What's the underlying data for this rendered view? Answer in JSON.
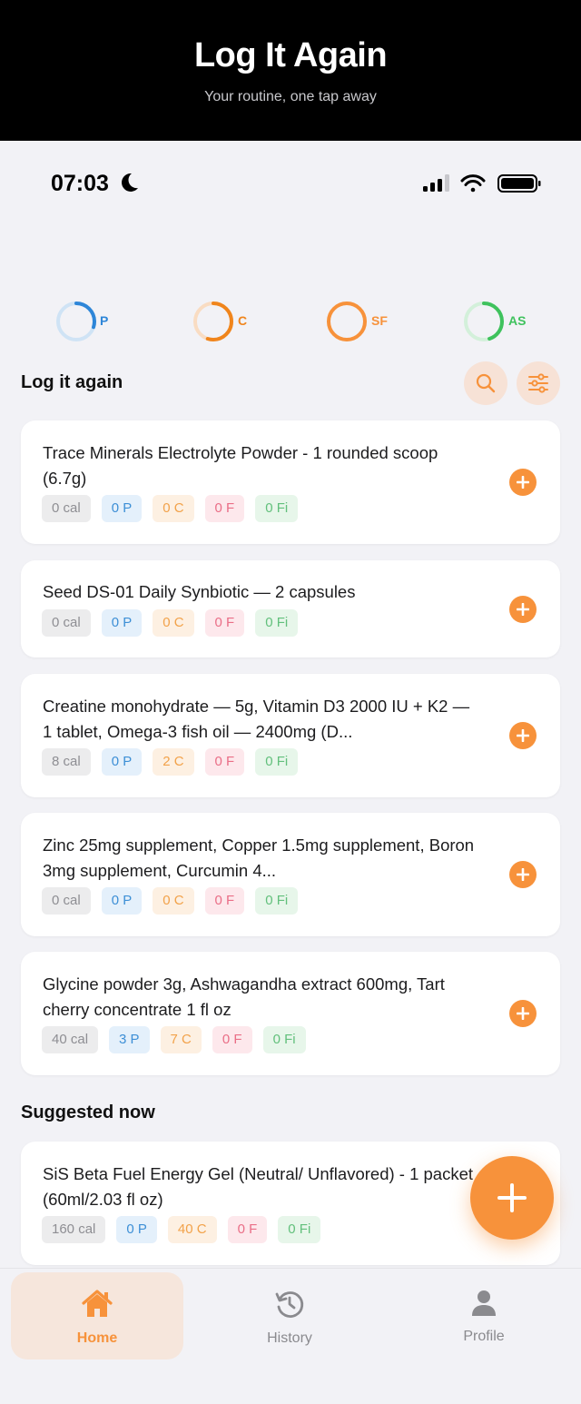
{
  "hero": {
    "title": "Log It Again",
    "subtitle": "Your routine, one tap away"
  },
  "status_bar": {
    "time": "07:03"
  },
  "rings": [
    {
      "label": "P",
      "color": "#2e86d8",
      "progress": 0.3
    },
    {
      "label": "C",
      "color": "#f0851c",
      "progress": 0.55
    },
    {
      "label": "SF",
      "color": "#f7923b",
      "progress": 1.0
    },
    {
      "label": "AS",
      "color": "#3fc25d",
      "progress": 0.45
    }
  ],
  "log_section": {
    "title": "Log it again"
  },
  "suggested_section": {
    "title": "Suggested now"
  },
  "cards": [
    {
      "title": "Trace Minerals Electrolyte Powder - 1 rounded scoop (6.7g)",
      "cal": "0 cal",
      "p": "0 P",
      "c": "0 C",
      "f": "0 F",
      "fi": "0 Fi"
    },
    {
      "title": "Seed DS-01 Daily Synbiotic — 2 capsules",
      "cal": "0 cal",
      "p": "0 P",
      "c": "0 C",
      "f": "0 F",
      "fi": "0 Fi"
    },
    {
      "title": "Creatine monohydrate — 5g, Vitamin D3 2000 IU + K2 — 1 tablet, Omega-3 fish oil — 2400mg (D...",
      "cal": "8 cal",
      "p": "0 P",
      "c": "2 C",
      "f": "0 F",
      "fi": "0 Fi"
    },
    {
      "title": "Zinc 25mg supplement, Copper 1.5mg supplement, Boron 3mg supplement, Curcumin 4...",
      "cal": "0 cal",
      "p": "0 P",
      "c": "0 C",
      "f": "0 F",
      "fi": "0 Fi"
    },
    {
      "title": "Glycine powder 3g, Ashwagandha extract 600mg, Tart cherry concentrate 1 fl oz",
      "cal": "40 cal",
      "p": "3 P",
      "c": "7 C",
      "f": "0 F",
      "fi": "0 Fi"
    }
  ],
  "suggested": [
    {
      "title": "SiS Beta Fuel Energy Gel (Neutral/ Unflavored) - 1 packet (60ml/2.03 fl oz)",
      "cal": "160 cal",
      "p": "0 P",
      "c": "40 C",
      "f": "0 F",
      "fi": "0 Fi"
    }
  ],
  "tabs": [
    {
      "label": "Home",
      "icon": "home-icon",
      "active": true
    },
    {
      "label": "History",
      "icon": "history-icon",
      "active": false
    },
    {
      "label": "Profile",
      "icon": "profile-icon",
      "active": false
    }
  ],
  "colors": {
    "accent": "#f7923b",
    "hero_bg": "#000000"
  }
}
